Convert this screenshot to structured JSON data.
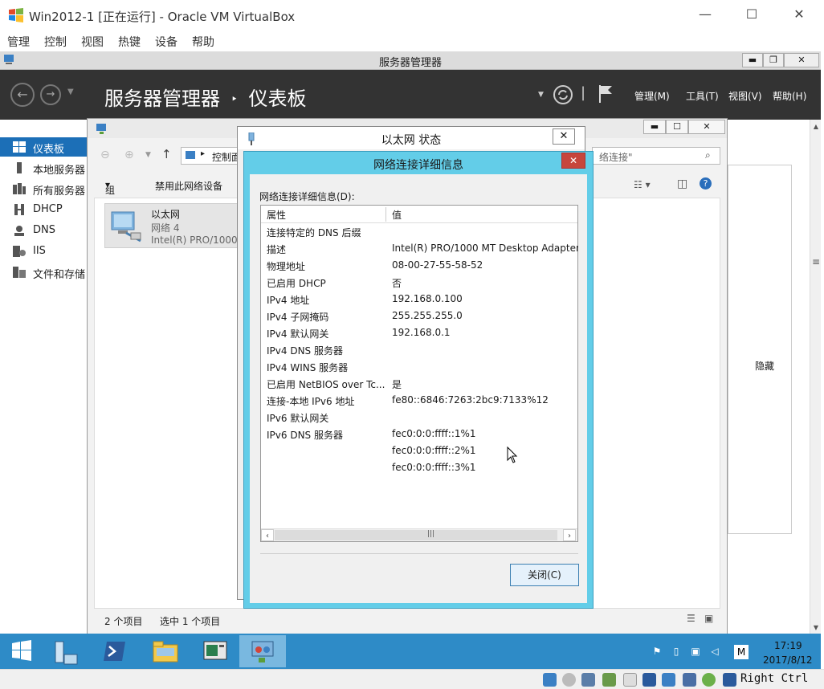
{
  "host_window": {
    "title": "Win2012-1 [正在运行] - Oracle VM VirtualBox",
    "minimize": "—",
    "maximize": "☐",
    "close": "✕",
    "menu": [
      "管理",
      "控制",
      "视图",
      "热键",
      "设备",
      "帮助"
    ]
  },
  "server_manager": {
    "window_title": "服务器管理器",
    "breadcrumb_root": "服务器管理器",
    "breadcrumb_sep": "‣",
    "breadcrumb_current": "仪表板",
    "header_menu": [
      "管理(M)",
      "工具(T)",
      "视图(V)",
      "帮助(H)"
    ],
    "sidebar": [
      {
        "label": "仪表板",
        "icon": "dashboard-icon",
        "active": true
      },
      {
        "label": "本地服务器",
        "icon": "server-icon",
        "active": false
      },
      {
        "label": "所有服务器",
        "icon": "servers-icon",
        "active": false
      },
      {
        "label": "DHCP",
        "icon": "dhcp-icon",
        "active": false
      },
      {
        "label": "DNS",
        "icon": "dns-icon",
        "active": false
      },
      {
        "label": "IIS",
        "icon": "iis-icon",
        "active": false
      },
      {
        "label": "文件和存储",
        "icon": "storage-icon",
        "active": false
      }
    ],
    "hide_label": "隐藏",
    "accent": "#1c6fb7"
  },
  "network_connections": {
    "address_text": "控制面",
    "search_placeholder": "络连接\"",
    "toolbar": {
      "organize": "组织",
      "disable": "禁用此网络设备"
    },
    "adapter": {
      "name": "以太网",
      "network": "网络  4",
      "device": "Intel(R) PRO/1000"
    },
    "status_items": "2 个项目",
    "status_selected": "选中 1 个项目"
  },
  "ethernet_status": {
    "title": "以太网 状态"
  },
  "details_dialog": {
    "title": "网络连接详细信息",
    "label": "网络连接详细信息(D):",
    "col_property": "属性",
    "col_value": "值",
    "rows": [
      {
        "k": "连接特定的 DNS 后缀",
        "v": ""
      },
      {
        "k": "描述",
        "v": "Intel(R) PRO/1000 MT Desktop Adapter"
      },
      {
        "k": "物理地址",
        "v": "08-00-27-55-58-52"
      },
      {
        "k": "已启用 DHCP",
        "v": "否"
      },
      {
        "k": "IPv4 地址",
        "v": "192.168.0.100"
      },
      {
        "k": "IPv4 子网掩码",
        "v": "255.255.255.0"
      },
      {
        "k": "IPv4 默认网关",
        "v": "192.168.0.1"
      },
      {
        "k": "IPv4 DNS 服务器",
        "v": ""
      },
      {
        "k": "IPv4 WINS 服务器",
        "v": ""
      },
      {
        "k": "已启用 NetBIOS over Tc...",
        "v": "是"
      },
      {
        "k": "连接-本地 IPv6 地址",
        "v": "fe80::6846:7263:2bc9:7133%12"
      },
      {
        "k": "IPv6 默认网关",
        "v": ""
      },
      {
        "k": "IPv6 DNS 服务器",
        "v": "fec0:0:0:ffff::1%1"
      },
      {
        "k": "",
        "v": "fec0:0:0:ffff::2%1"
      },
      {
        "k": "",
        "v": "fec0:0:0:ffff::3%1"
      }
    ],
    "close_button": "关闭(C)",
    "close_x": "✕",
    "scroll_grip": "|||"
  },
  "taskbar": {
    "clock_time": "17:19",
    "clock_date": "2017/8/12",
    "ime": "M"
  },
  "vbox_status": {
    "host_key": "Right Ctrl"
  }
}
